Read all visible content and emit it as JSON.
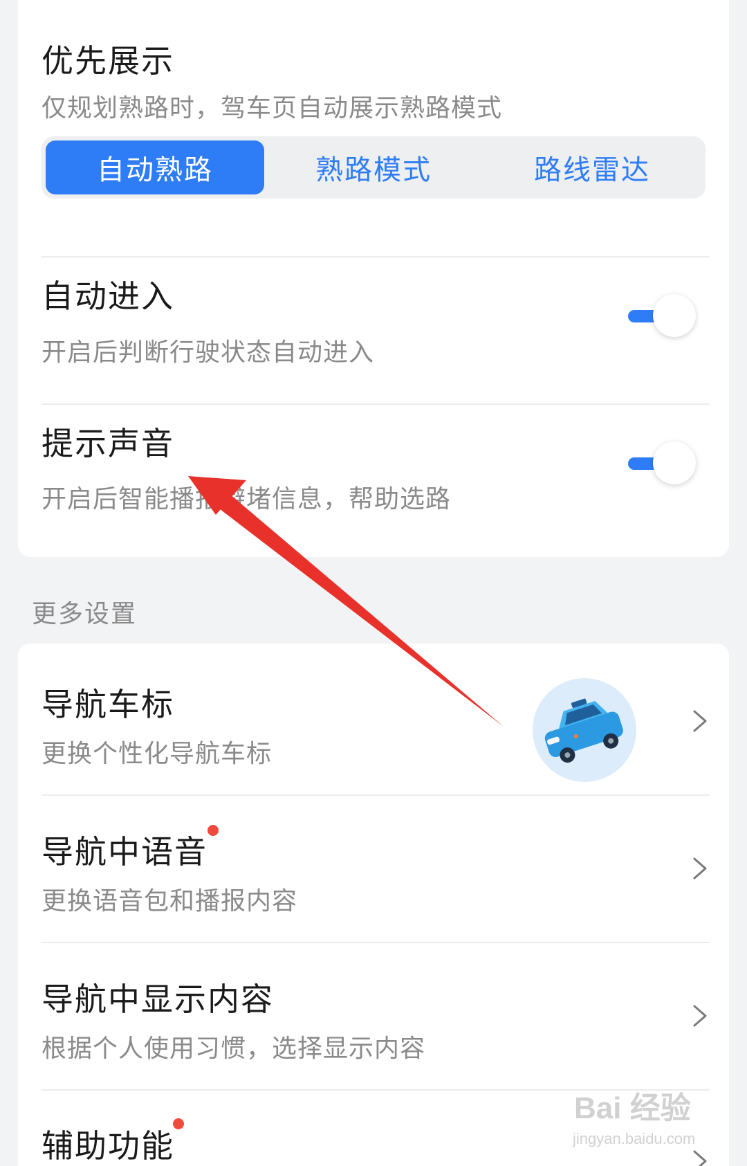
{
  "card_top": {
    "priority": {
      "title": "优先展示",
      "subtitle": "仅规划熟路时，驾车页自动展示熟路模式",
      "options": [
        "自动熟路",
        "熟路模式",
        "路线雷达"
      ],
      "selected": "自动熟路"
    },
    "auto_enter": {
      "title": "自动进入",
      "subtitle": "开启后判断行驶状态自动进入",
      "enabled": true
    },
    "sound": {
      "title": "提示声音",
      "subtitle": "开启后智能播报避堵信息，帮助选路",
      "enabled": true
    }
  },
  "section_label": "更多设置",
  "more_settings": [
    {
      "title": "导航车标",
      "subtitle": "更换个性化导航车标",
      "has_dot": false
    },
    {
      "title": "导航中语音",
      "subtitle": "更换语音包和播报内容",
      "has_dot": true
    },
    {
      "title": "导航中显示内容",
      "subtitle": "根据个人使用习惯，选择显示内容",
      "has_dot": false
    },
    {
      "title": "辅助功能",
      "subtitle": "",
      "has_dot": true
    }
  ],
  "watermark": {
    "logo": "Bai 经验",
    "url": "jingyan.baidu.com"
  },
  "colors": {
    "accent": "#2f7df6",
    "dot": "#f04a3e",
    "annotation_arrow": "#e8312a"
  },
  "icons": [
    "chevron-right-icon",
    "car-icon",
    "toggle-switch",
    "annotation-arrow"
  ]
}
